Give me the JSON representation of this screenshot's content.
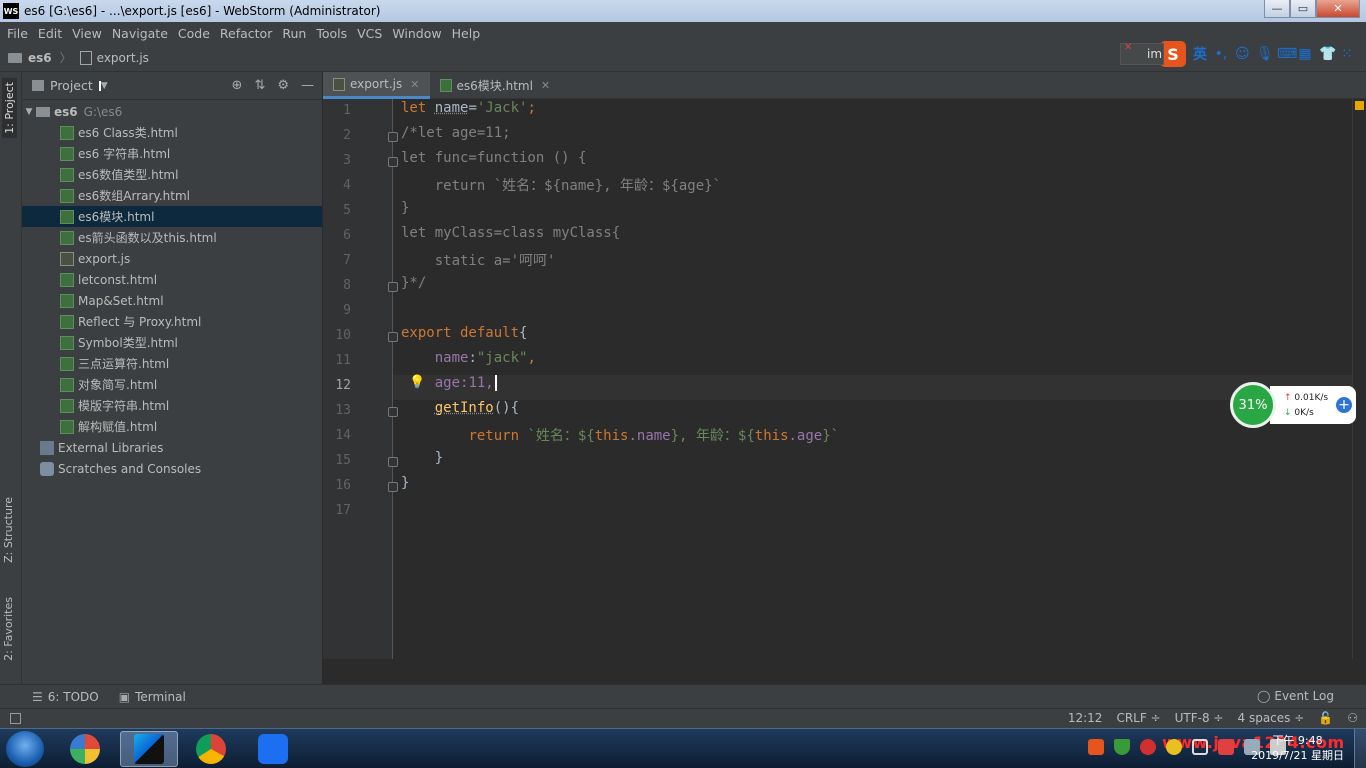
{
  "window": {
    "title": "es6 [G:\\es6] - ...\\export.js [es6] - WebStorm (Administrator)",
    "logo": "WS"
  },
  "menu": [
    "File",
    "Edit",
    "View",
    "Navigate",
    "Code",
    "Refactor",
    "Run",
    "Tools",
    "VCS",
    "Window",
    "Help"
  ],
  "ime": {
    "search_text": "im",
    "lang": "英",
    "logo": "S"
  },
  "breadcrumb": {
    "project": "es6",
    "file": "export.js"
  },
  "left_strip": {
    "project": "1: Project",
    "structure": "Z: Structure",
    "favorites": "2: Favorites"
  },
  "project_panel": {
    "title": "Project",
    "root": {
      "name": "es6",
      "path": "G:\\es6"
    },
    "files": [
      {
        "name": "es6 Class类.html",
        "type": "html"
      },
      {
        "name": "es6 字符串.html",
        "type": "html"
      },
      {
        "name": "es6数值类型.html",
        "type": "html"
      },
      {
        "name": "es6数组Arrary.html",
        "type": "html"
      },
      {
        "name": "es6模块.html",
        "type": "html"
      },
      {
        "name": "es箭头函数以及this.html",
        "type": "html"
      },
      {
        "name": "export.js",
        "type": "js"
      },
      {
        "name": "letconst.html",
        "type": "html"
      },
      {
        "name": "Map&Set.html",
        "type": "html"
      },
      {
        "name": "Reflect 与 Proxy.html",
        "type": "html"
      },
      {
        "name": "Symbol类型.html",
        "type": "html"
      },
      {
        "name": "三点运算符.html",
        "type": "html"
      },
      {
        "name": "对象简写.html",
        "type": "html"
      },
      {
        "name": "模版字符串.html",
        "type": "html"
      },
      {
        "name": "解构赋值.html",
        "type": "html"
      }
    ],
    "selected_file": "es6模块.html",
    "extra": [
      "External Libraries",
      "Scratches and Consoles"
    ]
  },
  "tabs": [
    {
      "label": "export.js",
      "active": true
    },
    {
      "label": "es6模块.html",
      "active": false
    }
  ],
  "editor": {
    "line_numbers": [
      "1",
      "2",
      "3",
      "4",
      "5",
      "6",
      "7",
      "8",
      "9",
      "10",
      "11",
      "12",
      "13",
      "14",
      "15",
      "16",
      "17"
    ],
    "current_line": "12",
    "code": {
      "l1_kw": "let ",
      "l1_var": "name",
      "l1_rest": "=",
      "l1_str": "'Jack'",
      "l1_end": ";",
      "l2": "/*let age=11;",
      "l3": "let func=function () {",
      "l4": "    return `姓名：${name}, 年龄：${age}`",
      "l5": "}",
      "l6": "let myClass=class myClass{",
      "l7": "    static a='呵呵'",
      "l8": "}*/",
      "l10_kw": "export default",
      "l10_rest": "{",
      "l11_prop": "name",
      "l11_colon": ":",
      "l11_str": "\"jack\"",
      "l11_end": ",",
      "l12_prop": "age",
      "l12_rest": ":11,",
      "l13_fn": "getInfo",
      "l13_rest": "(){",
      "l14_kw": "return ",
      "l14_t1": "`姓名：${",
      "l14_this1": "this",
      "l14_p1": ".name",
      "l14_t2": "}, 年龄：${",
      "l14_this2": "this",
      "l14_p2": ".age",
      "l14_t3": "}`",
      "l15": "}",
      "l16": "}"
    }
  },
  "speed_widget": {
    "percent": "31%",
    "up": "0.01K/s",
    "down": "0K/s"
  },
  "bottom_tools": {
    "todo": "6: TODO",
    "terminal": "Terminal",
    "event_log": "Event Log"
  },
  "status": {
    "position": "12:12",
    "line_sep": "CRLF ÷",
    "encoding": "UTF-8 ÷",
    "indent": "4 spaces ÷"
  },
  "taskbar": {
    "watermark": "www.java1234.com",
    "time": "下午 9:48",
    "date": "2019/7/21 星期日"
  },
  "colors": {
    "bg": "#2b2b2b",
    "panel": "#3c3f41",
    "keyword": "#cc7832",
    "string": "#6a8759",
    "property": "#9876aa",
    "function": "#ffc66d",
    "selection": "#0d293e"
  }
}
